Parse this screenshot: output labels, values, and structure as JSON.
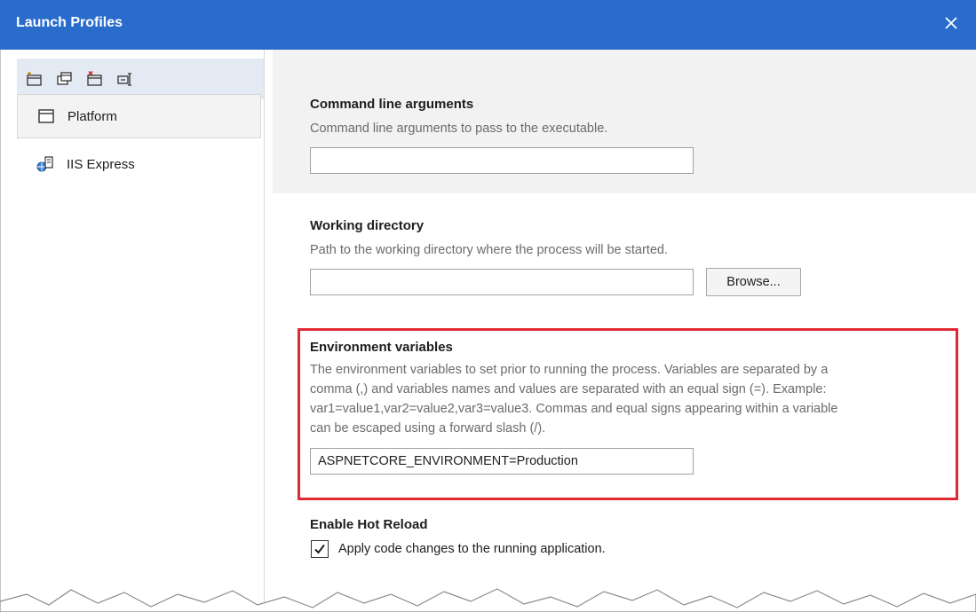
{
  "window": {
    "title": "Launch Profiles",
    "close_icon": "close-icon"
  },
  "sidebar": {
    "toolbar_icons": [
      "new-profile-icon",
      "copy-profile-icon",
      "delete-profile-icon",
      "rename-profile-icon"
    ],
    "profiles": [
      {
        "label": "Platform",
        "icon": "window-icon",
        "selected": true
      },
      {
        "label": "IIS Express",
        "icon": "iis-globe-icon",
        "selected": false
      }
    ]
  },
  "main": {
    "command_line": {
      "label": "Command line arguments",
      "description": "Command line arguments to pass to the executable.",
      "value": ""
    },
    "working_dir": {
      "label": "Working directory",
      "description": "Path to the working directory where the process will be started.",
      "value": "",
      "browse_label": "Browse..."
    },
    "env_vars": {
      "label": "Environment variables",
      "description_lines": [
        "The environment variables to set prior to running the process. Variables are separated by a",
        "comma (,) and variables names and values are separated with an equal sign (=). Example:",
        "var1=value1,var2=value2,var3=value3. Commas and equal signs appearing within a variable",
        "can be escaped using a forward slash (/)."
      ],
      "value": "ASPNETCORE_ENVIRONMENT=Production",
      "highlight_color": "#e02a32"
    },
    "hot_reload": {
      "label": "Enable Hot Reload",
      "checkbox_label": "Apply code changes to the running application.",
      "checked": true
    }
  },
  "colors": {
    "titlebar": "#2a6ccb",
    "panel_gray": "#f2f2f2"
  }
}
